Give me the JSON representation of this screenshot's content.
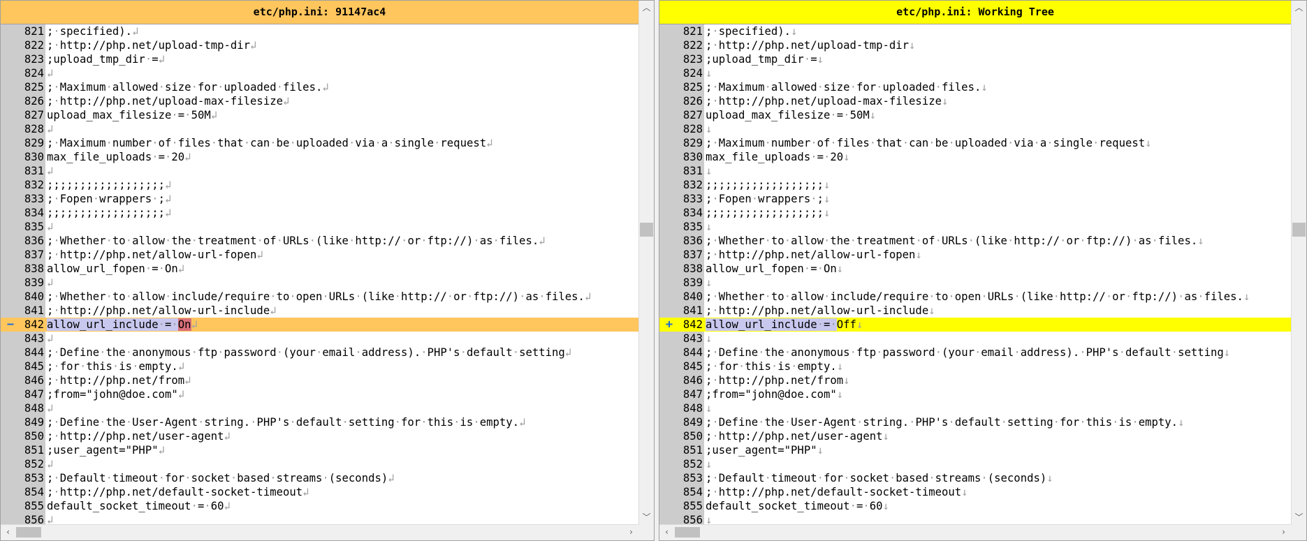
{
  "left_pane": {
    "title": "etc/php.ini: 91147ac4",
    "eol_glyph": "↲",
    "changed_marker": "−",
    "color": "#ffc65d"
  },
  "right_pane": {
    "title": "etc/php.ini: Working Tree",
    "eol_glyph": "↓",
    "changed_marker": "+",
    "color": "#ffff00"
  },
  "changed_line": 842,
  "left_changed_text": {
    "prefix": "allow_url_include = ",
    "value": "On"
  },
  "right_changed_text": {
    "prefix": "allow_url_include = ",
    "value": "Off"
  },
  "lines": [
    {
      "n": 821,
      "text": "; specified)."
    },
    {
      "n": 822,
      "text": "; http://php.net/upload-tmp-dir"
    },
    {
      "n": 823,
      "text": ";upload_tmp_dir ="
    },
    {
      "n": 824,
      "text": ""
    },
    {
      "n": 825,
      "text": "; Maximum allowed size for uploaded files."
    },
    {
      "n": 826,
      "text": "; http://php.net/upload-max-filesize"
    },
    {
      "n": 827,
      "text": "upload_max_filesize = 50M"
    },
    {
      "n": 828,
      "text": ""
    },
    {
      "n": 829,
      "text": "; Maximum number of files that can be uploaded via a single request"
    },
    {
      "n": 830,
      "text": "max_file_uploads = 20"
    },
    {
      "n": 831,
      "text": ""
    },
    {
      "n": 832,
      "text": ";;;;;;;;;;;;;;;;;;"
    },
    {
      "n": 833,
      "text": "; Fopen wrappers ;"
    },
    {
      "n": 834,
      "text": ";;;;;;;;;;;;;;;;;;"
    },
    {
      "n": 835,
      "text": ""
    },
    {
      "n": 836,
      "text": "; Whether to allow the treatment of URLs (like http:// or ftp://) as files."
    },
    {
      "n": 837,
      "text": "; http://php.net/allow-url-fopen"
    },
    {
      "n": 838,
      "text": "allow_url_fopen = On"
    },
    {
      "n": 839,
      "text": ""
    },
    {
      "n": 840,
      "text": "; Whether to allow include/require to open URLs (like http:// or ftp://) as files."
    },
    {
      "n": 841,
      "text": "; http://php.net/allow-url-include"
    },
    {
      "n": 842,
      "text": ""
    },
    {
      "n": 843,
      "text": ""
    },
    {
      "n": 844,
      "text": "; Define the anonymous ftp password (your email address). PHP's default setting"
    },
    {
      "n": 845,
      "text": "; for this is empty."
    },
    {
      "n": 846,
      "text": "; http://php.net/from"
    },
    {
      "n": 847,
      "text": ";from=\"john@doe.com\""
    },
    {
      "n": 848,
      "text": ""
    },
    {
      "n": 849,
      "text": "; Define the User-Agent string. PHP's default setting for this is empty."
    },
    {
      "n": 850,
      "text": "; http://php.net/user-agent"
    },
    {
      "n": 851,
      "text": ";user_agent=\"PHP\""
    },
    {
      "n": 852,
      "text": ""
    },
    {
      "n": 853,
      "text": "; Default timeout for socket based streams (seconds)"
    },
    {
      "n": 854,
      "text": "; http://php.net/default-socket-timeout"
    },
    {
      "n": 855,
      "text": "default_socket_timeout = 60"
    },
    {
      "n": 856,
      "text": ""
    }
  ]
}
